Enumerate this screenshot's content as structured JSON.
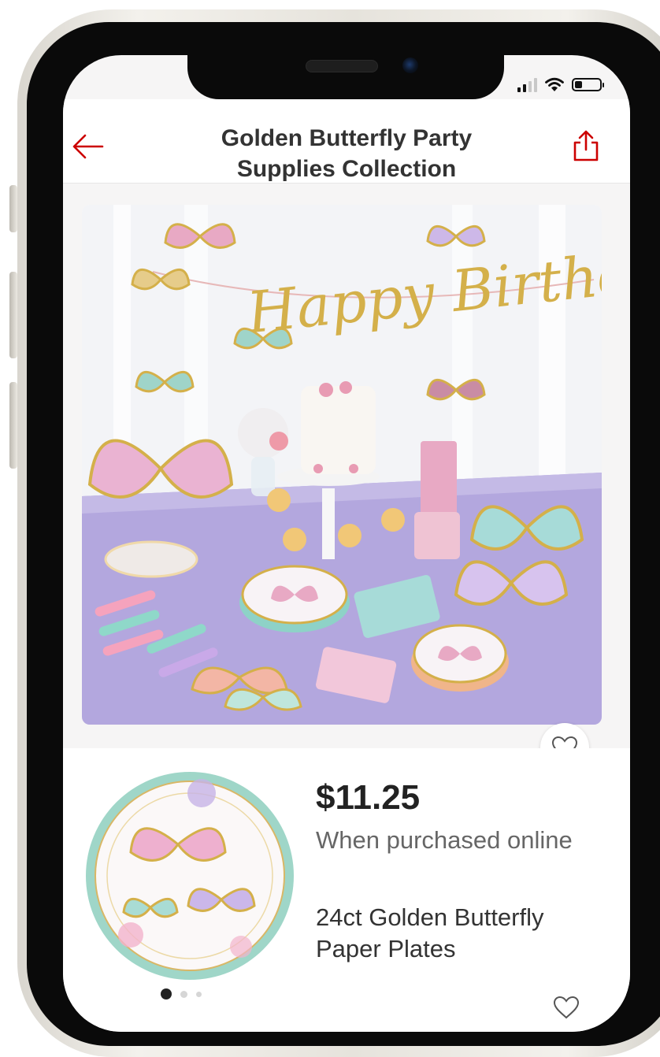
{
  "header": {
    "title_line1": "Golden Butterfly Party",
    "title_line2": "Supplies Collection"
  },
  "hero": {
    "banner_text": "Happy Birthday"
  },
  "product": {
    "price": "$11.25",
    "price_qualifier": "When purchased online",
    "name": "24ct Golden Butterfly Paper Plates",
    "carousel": {
      "total": 3,
      "active": 1
    }
  },
  "icons": {
    "back": "arrow-left-icon",
    "share": "share-icon",
    "favorite": "heart-outline-icon",
    "signal": "cellular-signal-icon",
    "wifi": "wifi-icon",
    "battery": "battery-icon"
  },
  "colors": {
    "accent_red": "#cc0000",
    "tablecloth": "#b3a7de",
    "gold": "#d4b04a"
  }
}
